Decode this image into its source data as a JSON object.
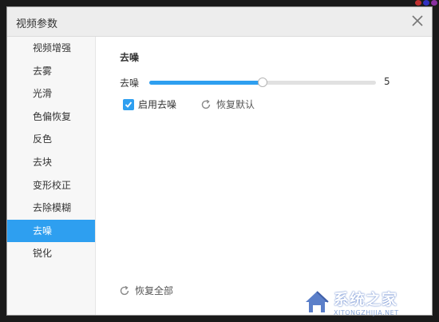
{
  "window": {
    "title": "视频参数"
  },
  "sidebar": {
    "items": [
      {
        "label": "视频增强"
      },
      {
        "label": "去雾"
      },
      {
        "label": "光滑"
      },
      {
        "label": "色偏恢复"
      },
      {
        "label": "反色"
      },
      {
        "label": "去块"
      },
      {
        "label": "变形校正"
      },
      {
        "label": "去除模糊"
      },
      {
        "label": "去噪",
        "active": true
      },
      {
        "label": "锐化"
      }
    ]
  },
  "panel": {
    "section_title": "去噪",
    "slider_label": "去噪",
    "slider_value": "5",
    "slider_fraction": 0.5,
    "enable_checkbox_label": "启用去噪",
    "enable_checked": true,
    "reset_default_label": "恢复默认",
    "reset_all_label": "恢复全部"
  },
  "watermark": {
    "text": "系统之家",
    "sub": "XITONGZHIJIA.NET"
  },
  "colors": {
    "accent": "#2e9ff0"
  }
}
